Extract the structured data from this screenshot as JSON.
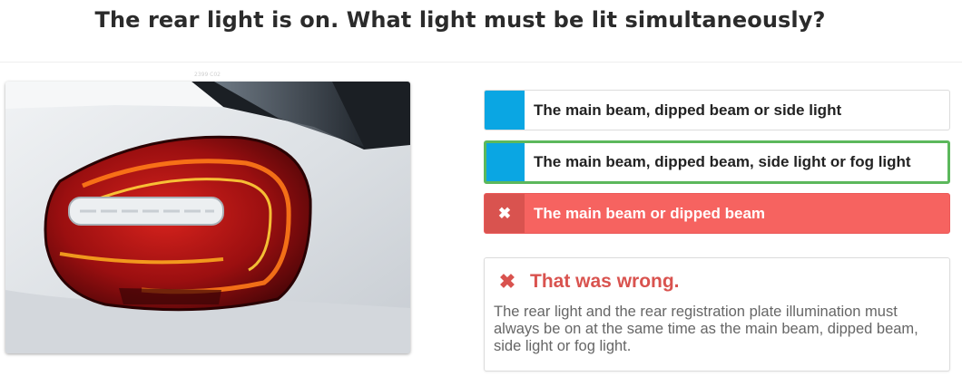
{
  "question": {
    "title": "The rear light is on. What light must be lit simultaneously?"
  },
  "image": {
    "caption": "2399 C02",
    "icon": "car-rear-light-photo"
  },
  "answers": [
    {
      "label": "The main beam, dipped beam or side light",
      "state": "neutral"
    },
    {
      "label": "The main beam, dipped beam, side light or fog light",
      "state": "correct"
    },
    {
      "label": "The main beam or dipped beam",
      "state": "wrong",
      "icon": "✖"
    }
  ],
  "feedback": {
    "icon": "✖",
    "title": "That was wrong.",
    "text": "The rear light and the rear registration plate illumination must always be on at the same time as the main beam, dipped beam, side light or fog light."
  },
  "colors": {
    "marker_blue": "#0aa6e3",
    "correct_green": "#5cb85c",
    "wrong_red": "#f66360",
    "error_text": "#d9534f"
  }
}
